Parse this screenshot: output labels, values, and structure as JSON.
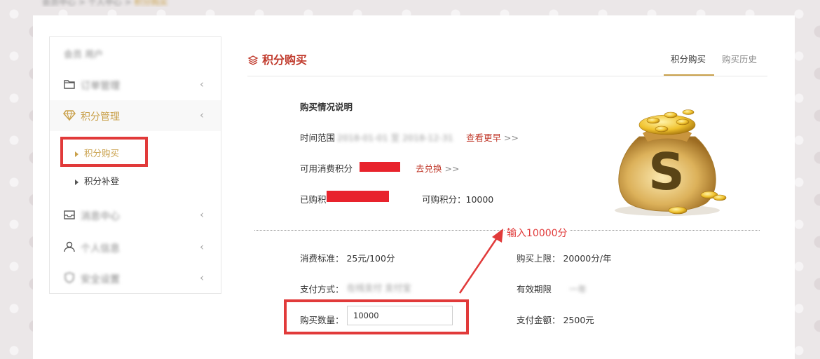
{
  "topbar": {
    "crumb_blur": "会员中心 > 个人中心 >",
    "crumb_hl": "积分购买"
  },
  "sidebar": {
    "user_blur": "会员 用户",
    "items": [
      {
        "label": "订单管理",
        "icon": "folder-icon",
        "blurred": true
      },
      {
        "label": "积分管理",
        "icon": "diamond-icon",
        "blurred": false
      },
      {
        "label": "消息中心",
        "icon": "inbox-icon",
        "blurred": true
      },
      {
        "label": "个人信息",
        "icon": "user-icon",
        "blurred": true
      },
      {
        "label": "安全设置",
        "icon": "shield-icon",
        "blurred": true
      }
    ],
    "subitems": [
      "积分购买",
      "积分补登"
    ]
  },
  "main": {
    "title": "积分购买",
    "tabs": [
      "积分购买",
      "购买历史"
    ],
    "section_title": "购买情况说明",
    "time_range_label": "时间范围",
    "time_range_blur": "2018-01-01 至 2018-12-31",
    "more_link": "查看更早",
    "more_arrow": ">>",
    "available_label": "可用消费积分",
    "redeem_link": "去兑换",
    "redeem_arrow": ">>",
    "bought_label": "已购积",
    "can_buy_label": "可购积分：10000",
    "annotation": "输入10000分",
    "price_label": "消费标准： 25元/100分",
    "limit_label": "购买上限： 20000分/年",
    "payment_label": "支付方式：",
    "payment_blur": "在线支付 支付宝",
    "validity_label": "有效期限",
    "validity_blur": "一年",
    "qty_label": "购买数量：",
    "qty_value": "10000",
    "amount_label": "支付金额： 2500元"
  },
  "colors": {
    "accent": "#c9a04a",
    "highlight_red": "#e13a3a",
    "link_red": "#c0392b"
  }
}
